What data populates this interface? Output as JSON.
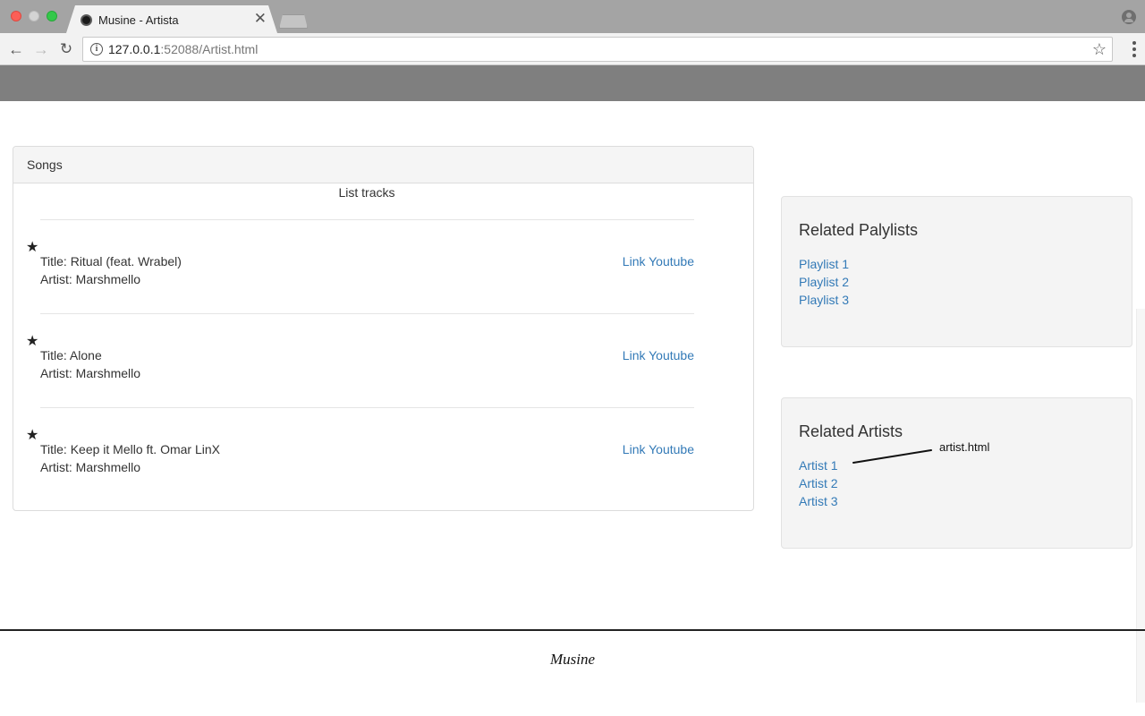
{
  "browser": {
    "tab_title": "Musine - Artista",
    "tab_close": "✕",
    "url_host": "127.0.0.1",
    "url_rest": ":52088/Artist.html"
  },
  "songs": {
    "heading": "Songs",
    "list_title": "List tracks",
    "tracks": [
      {
        "title": "Title: Ritual (feat. Wrabel)",
        "artist": "Artist: Marshmello",
        "link": "Link Youtube"
      },
      {
        "title": "Title: Alone",
        "artist": "Artist: Marshmello",
        "link": "Link Youtube"
      },
      {
        "title": "Title: Keep it Mello ft. Omar LinX",
        "artist": "Artist: Marshmello",
        "link": "Link Youtube"
      }
    ]
  },
  "related_playlists": {
    "title": "Related Palylists",
    "items": [
      "Playlist 1",
      "Playlist 2",
      "Playlist 3"
    ]
  },
  "related_artists": {
    "title": "Related Artists",
    "items": [
      "Artist 1",
      "Artist 2",
      "Artist 3"
    ]
  },
  "annotation": {
    "text": "artist.html"
  },
  "footer": {
    "brand": "Musine"
  },
  "colors": {
    "link": "#337ab7",
    "navbar": "#7f7f7f"
  }
}
